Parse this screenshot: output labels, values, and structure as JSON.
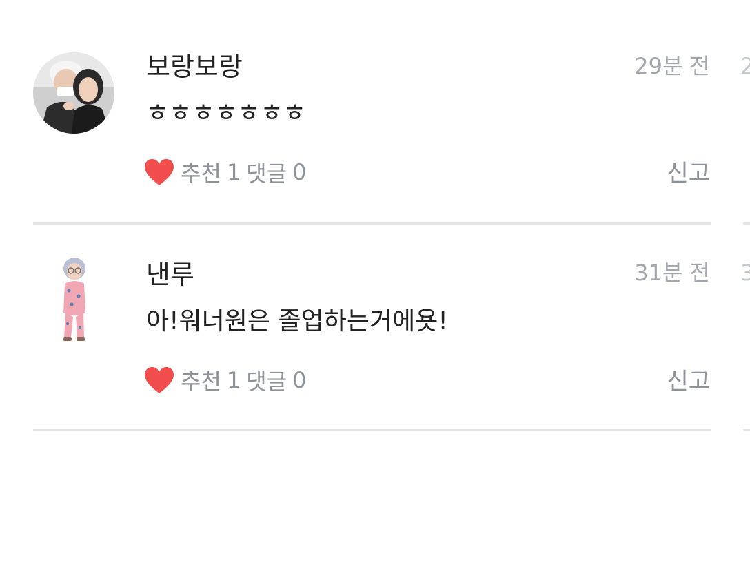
{
  "comments": [
    {
      "username": "보랑보랑",
      "timestamp": "29분 전",
      "edge_digit": "2",
      "text": "ㅎㅎㅎㅎㅎㅎㅎ",
      "recommend_label": "추천",
      "recommend_count": "1",
      "reply_label": "댓글",
      "reply_count": "0",
      "report_label": "신고"
    },
    {
      "username": "낸루",
      "timestamp": "31분 전",
      "edge_digit": "3",
      "text": "아!워너원은 졸업하는거에욧!",
      "recommend_label": "추천",
      "recommend_count": "1",
      "reply_label": "댓글",
      "reply_count": "0",
      "report_label": "신고"
    }
  ],
  "colors": {
    "heart": "#f24d4d",
    "meta_text": "#8e9399",
    "timestamp": "#a3a7ad",
    "divider": "#e3e4e6"
  }
}
